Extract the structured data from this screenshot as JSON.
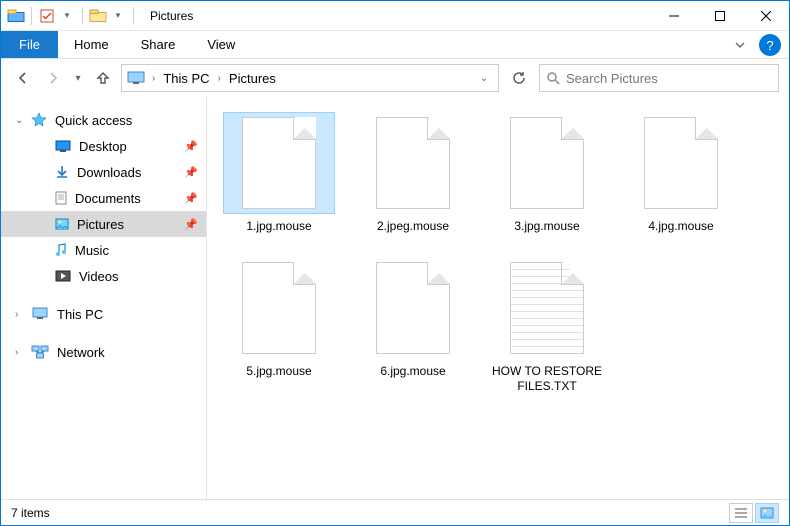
{
  "window": {
    "title": "Pictures",
    "minimize_tooltip": "Minimize",
    "maximize_tooltip": "Maximize",
    "close_tooltip": "Close"
  },
  "ribbon": {
    "file": "File",
    "tabs": [
      "Home",
      "Share",
      "View"
    ]
  },
  "breadcrumbs": {
    "items": [
      "This PC",
      "Pictures"
    ]
  },
  "search": {
    "placeholder": "Search Pictures"
  },
  "sidebar": {
    "quick_access": "Quick access",
    "items": [
      {
        "label": "Desktop",
        "pinned": true
      },
      {
        "label": "Downloads",
        "pinned": true
      },
      {
        "label": "Documents",
        "pinned": true
      },
      {
        "label": "Pictures",
        "pinned": true,
        "selected": true
      },
      {
        "label": "Music",
        "pinned": false
      },
      {
        "label": "Videos",
        "pinned": false
      }
    ],
    "this_pc": "This PC",
    "network": "Network"
  },
  "files": [
    {
      "name": "1.jpg.mouse",
      "type": "generic",
      "selected": true
    },
    {
      "name": "2.jpeg.mouse",
      "type": "generic"
    },
    {
      "name": "3.jpg.mouse",
      "type": "generic"
    },
    {
      "name": "4.jpg.mouse",
      "type": "generic"
    },
    {
      "name": "5.jpg.mouse",
      "type": "generic"
    },
    {
      "name": "6.jpg.mouse",
      "type": "generic"
    },
    {
      "name": "HOW TO RESTORE FILES.TXT",
      "type": "text"
    }
  ],
  "status": {
    "count_text": "7 items"
  }
}
